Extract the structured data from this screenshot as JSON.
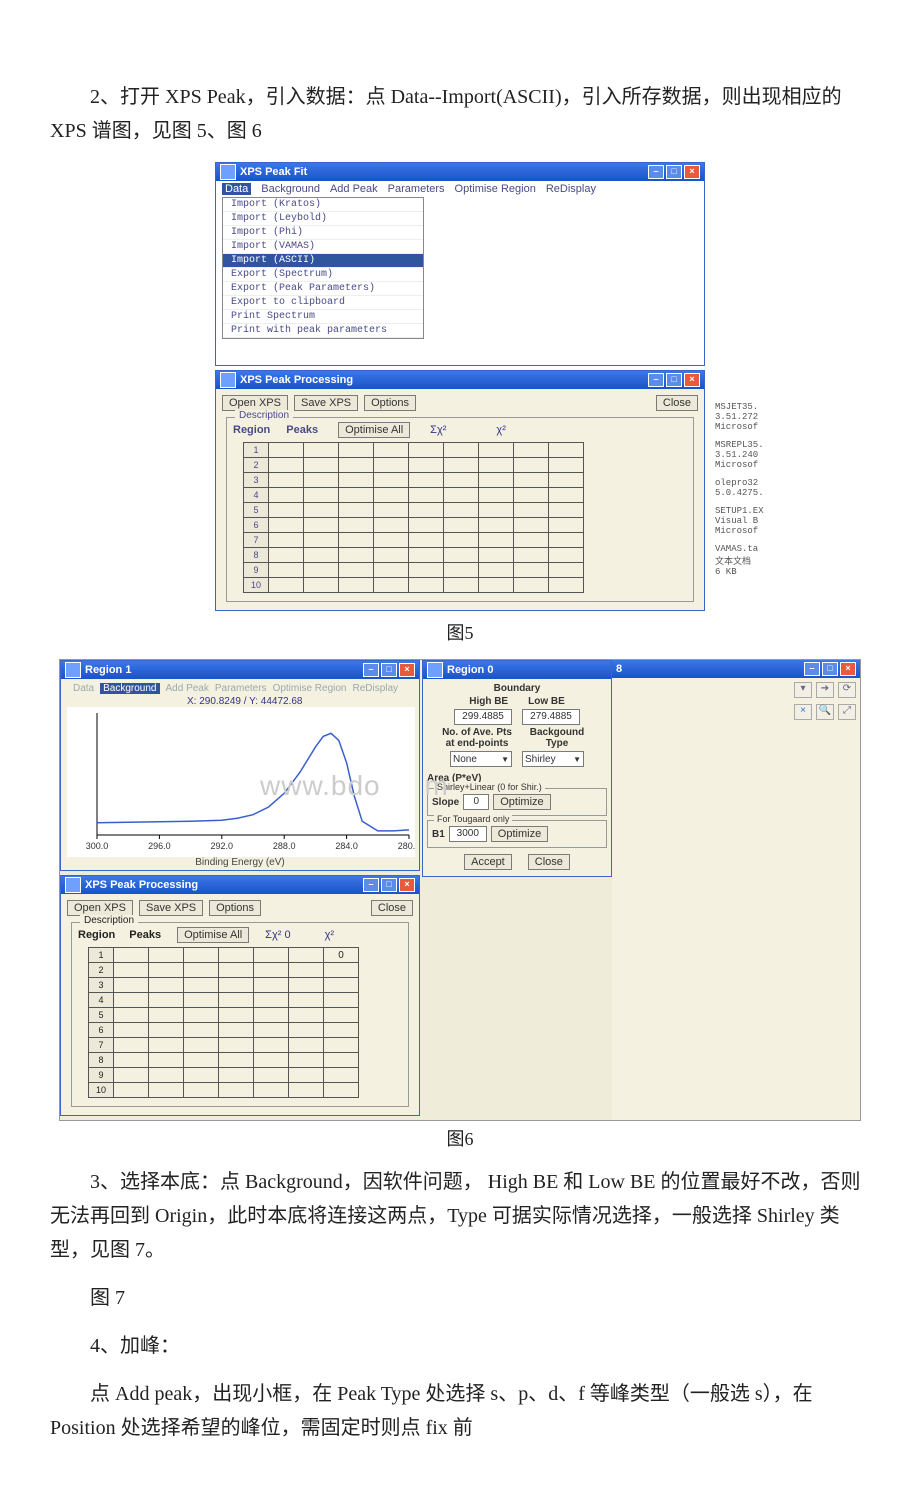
{
  "para2": "2、打开 XPS Peak，引入数据：点 Data--Import(ASCII)，引入所存数据，则出现相应的 XPS 谱图，见图 5、图 6",
  "cap5": "图5",
  "cap6": "图6",
  "para3": "3、选择本底：点 Background，因软件问题， High BE 和 Low BE 的位置最好不改，否则无法再回到 Origin，此时本底将连接这两点，Type 可据实际情况选择，一般选择 Shirley 类型，见图 7。",
  "para_fig7ph": "图 7",
  "para4": "4、加峰：",
  "para5": "点 Add peak，出现小框，在 Peak Type 处选择 s、p、d、f 等峰类型（一般选 s），在 Position 处选择希望的峰位，需固定时则点 fix 前",
  "fig5": {
    "fit_title": "XPS Peak Fit",
    "menu": {
      "data": "Data",
      "bg": "Background",
      "add": "Add Peak",
      "param": "Parameters",
      "opt": "Optimise Region",
      "red": "ReDisplay"
    },
    "menu_items": {
      "i1": "Import (Kratos)",
      "i2": "Import (Leybold)",
      "i3": "Import (Phi)",
      "i4": "Import (VAMAS)",
      "i5": "Import (ASCII)",
      "i6": "Export (Spectrum)",
      "i7": "Export (Peak Parameters)",
      "i8": "Export to clipboard",
      "i9": "Print Spectrum",
      "i10": "Print with peak parameters"
    },
    "proc_title": "XPS Peak Processing",
    "open": "Open XPS",
    "save": "Save XPS",
    "options": "Options",
    "close": "Close",
    "desc": "Description",
    "region": "Region",
    "peaks": "Peaks",
    "optall": "Optimise All",
    "chi2a": "Σχ²",
    "chi2b": "χ²",
    "side": {
      "g1a": "MSJET35.",
      "g1b": "3.51.272",
      "g1c": "Microsof",
      "g2a": "MSREPL35.",
      "g2b": "3.51.240",
      "g2c": "Microsof",
      "g3a": "olepro32",
      "g3b": "5.0.4275.",
      "g4a": "SETUP1.EX",
      "g4b": "Visual B",
      "g4c": "Microsof",
      "g5a": "VAMAS.ta",
      "g5b": "文本文档",
      "g5c": "6 KB"
    }
  },
  "fig6": {
    "region_title": "Region 1",
    "coord": "X: 290.8249 / Y: 44472.68",
    "xlabel": "Binding Energy (eV)",
    "proc_title": "XPS Peak Processing",
    "open": "Open XPS",
    "save": "Save XPS",
    "options": "Options",
    "close": "Close",
    "desc": "Description",
    "region": "Region",
    "peaks": "Peaks",
    "optall": "Optimise All",
    "chi2a": "Σχ² 0",
    "chi2b": "χ²",
    "val0": "0",
    "bg_title": "Region 0",
    "boundary": "Boundary",
    "high": "High BE",
    "low": "Low BE",
    "highv": "299.4885",
    "lowv": "279.4885",
    "avg": "No. of Ave. Pts at end-points",
    "bgtype": "Backgound Type",
    "none": "None",
    "shirley": "Shirley",
    "area": "Area (P*eV)",
    "sl_legend": "Shirley+Linear (0 for Shir.)",
    "slope": "Slope",
    "slopev": "0",
    "optimize": "Optimize",
    "tg_legend": "For Tougaard only",
    "b1": "B1",
    "b1v": "3000",
    "accept": "Accept",
    "close2": "Close",
    "panel_label": "8"
  },
  "chart_data": {
    "type": "line",
    "title": "Region 1",
    "xlabel": "Binding Energy (eV)",
    "ylabel": "",
    "xlim": [
      300,
      280
    ],
    "ylim": [
      26000,
      50000
    ],
    "x": [
      300.0,
      298.0,
      296.0,
      294.0,
      292.0,
      291.0,
      290.0,
      289.0,
      288.0,
      287.0,
      286.0,
      285.5,
      285.0,
      284.5,
      284.0,
      283.5,
      283.0,
      282.0,
      281.0,
      280.0
    ],
    "y": [
      28400,
      28500,
      28600,
      28700,
      28900,
      29300,
      30000,
      31500,
      34200,
      38300,
      43300,
      45400,
      46000,
      44600,
      40200,
      33600,
      28700,
      26800,
      26800,
      27000
    ],
    "note": "Single C1s-like XPS peak; x axis is reversed (high BE on left)."
  }
}
